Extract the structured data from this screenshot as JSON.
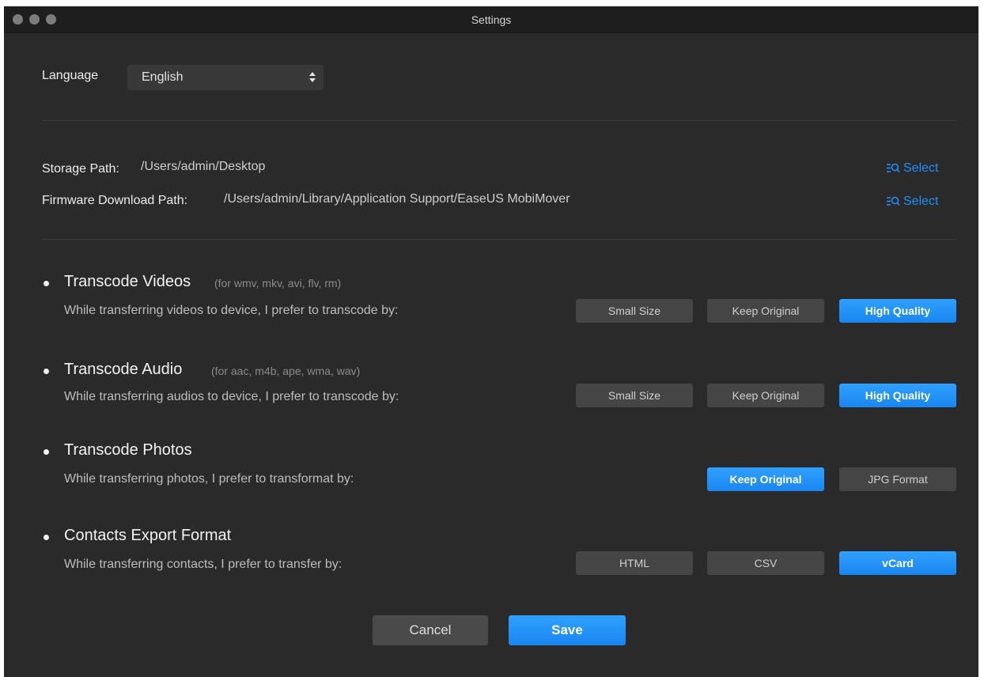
{
  "window": {
    "title": "Settings",
    "traffic_lights": [
      "close",
      "minimize",
      "zoom"
    ]
  },
  "language": {
    "label": "Language",
    "selected": "English"
  },
  "paths": {
    "storage_label": "Storage Path:",
    "storage_value": "/Users/admin/Desktop",
    "firmware_label": "Firmware Download Path:",
    "firmware_value": "/Users/admin/Library/Application Support/EaseUS MobiMover",
    "select_label": "Select",
    "select_icon": "folder-search-icon"
  },
  "sections": {
    "videos": {
      "title": "Transcode Videos",
      "note": "(for wmv, mkv, avi, flv, rm)",
      "desc": "While transferring videos to device, I prefer to transcode by:",
      "options": [
        "Small Size",
        "Keep Original",
        "High Quality"
      ],
      "selected": "High Quality"
    },
    "audio": {
      "title": "Transcode Audio",
      "note": "(for aac, m4b, ape, wma, wav)",
      "desc": "While transferring audios to device, I prefer to transcode by:",
      "options": [
        "Small Size",
        "Keep Original",
        "High Quality"
      ],
      "selected": "High Quality"
    },
    "photos": {
      "title": "Transcode Photos",
      "desc": "While transferring photos, I prefer to transformat by:",
      "options": [
        "Keep Original",
        "JPG Format"
      ],
      "selected": "Keep Original"
    },
    "contacts": {
      "title": "Contacts Export Format",
      "desc": "While transferring contacts, I prefer to transfer by:",
      "options": [
        "HTML",
        "CSV",
        "vCard"
      ],
      "selected": "vCard"
    }
  },
  "footer": {
    "cancel_label": "Cancel",
    "save_label": "Save"
  },
  "colors": {
    "background": "#2a2a2a",
    "accent": "#1f8fff",
    "option_inactive": "#454545"
  }
}
